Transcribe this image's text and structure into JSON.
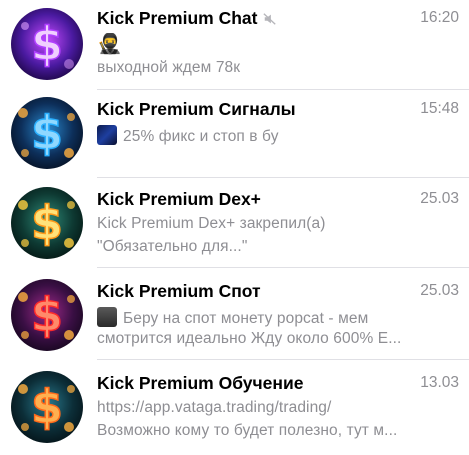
{
  "chats": [
    {
      "title": "Kick Premium Chat",
      "muted": true,
      "time": "16:20",
      "line1_emoji": "🥷",
      "line2": "выходной ждем 78к",
      "avatar_colors": [
        "#7b2ff7",
        "#2a0a5e",
        "#c84bff"
      ]
    },
    {
      "title": "Kick Premium Сигналы",
      "time": "15:48",
      "line1": "25% фикс и стоп в бу",
      "avatar_colors": [
        "#1a6fb0",
        "#071a33",
        "#ff8a2a"
      ]
    },
    {
      "title": "Kick Premium Dex+",
      "time": "25.03",
      "line1": "Kick Premium Dex+ закрепил(а)",
      "line2": "\"Обязательно для...\"",
      "avatar_colors": [
        "#1f6b5e",
        "#07221d",
        "#ffbf2a"
      ]
    },
    {
      "title": "Kick Premium Спот",
      "time": "25.03",
      "line1": "Беру на спот монету popcat - мем",
      "line2": "смотрится идеально Жду около 600% E...",
      "avatar_colors": [
        "#7a1f7a",
        "#1a0a2a",
        "#ff3b2a"
      ]
    },
    {
      "title": "Kick Premium Обучение",
      "time": "13.03",
      "line1": "https://app.vataga.trading/trading/",
      "line2": "Возможно кому то будет полезно, тут м...",
      "avatar_colors": [
        "#1a5a6e",
        "#081e26",
        "#ff9a2a"
      ]
    }
  ]
}
